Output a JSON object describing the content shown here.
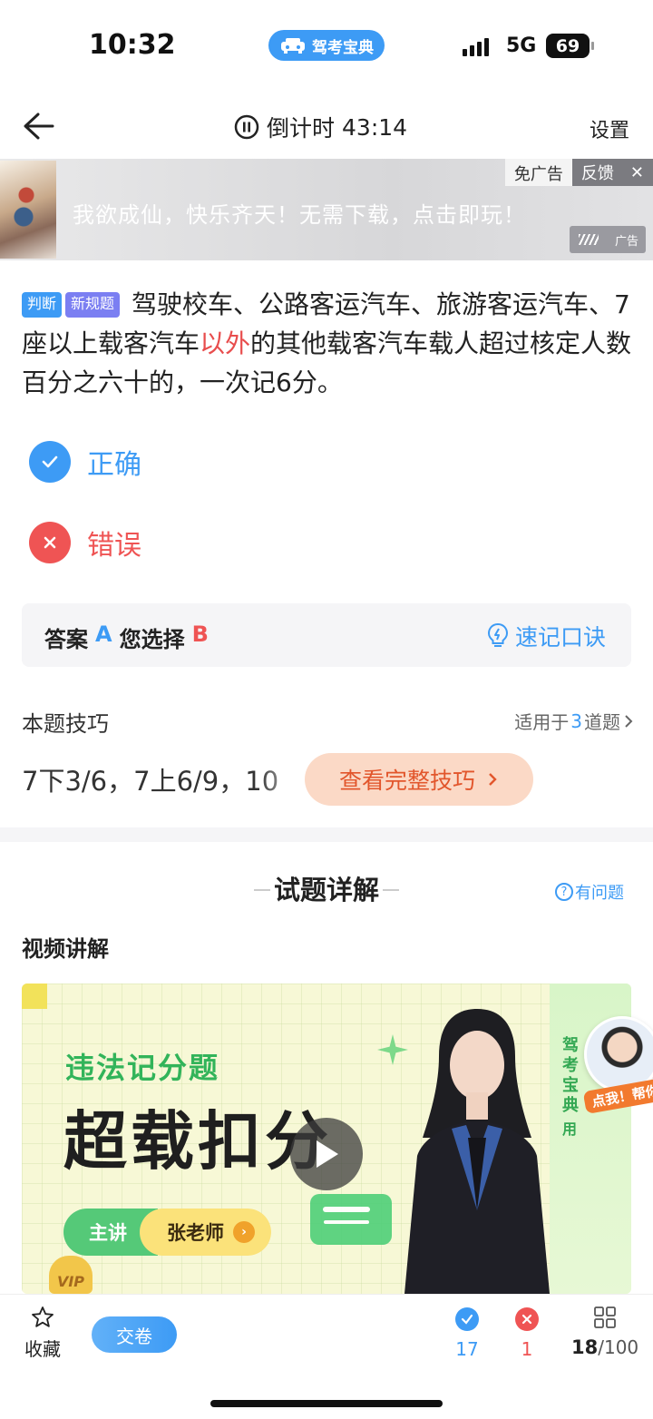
{
  "status_bar": {
    "time": "10:32",
    "app_pill": "驾考宝典",
    "network": "5G",
    "battery": "69"
  },
  "nav": {
    "timer_label": "倒计时",
    "timer_value": "43:14",
    "settings": "设置"
  },
  "ad": {
    "text": "我欲成仙，快乐齐天！无需下载，点击即玩！",
    "no_ads": "免广告",
    "feedback": "反馈",
    "close": "✕",
    "badge": "广告"
  },
  "question": {
    "tag_type": "判断",
    "tag_new": "新规题",
    "text_before": "驾驶校车、公路客运汽车、旅游客运汽车、7座以上载客汽车",
    "text_highlight": "以外",
    "text_after": "的其他载客汽车载人超过核定人数百分之六十的，一次记6分。"
  },
  "options": [
    {
      "label": "正确",
      "icon": "check-icon"
    },
    {
      "label": "错误",
      "icon": "cross-icon"
    }
  ],
  "answer": {
    "answer_label": "答案",
    "answer_value": "A",
    "chosen_label": "您选择",
    "chosen_value": "B",
    "mnemonic": "速记口诀"
  },
  "tips": {
    "title": "本题技巧",
    "applies_prefix": "适用于",
    "applies_count": "3",
    "applies_suffix": "道题",
    "content": "7下3/6，7上6/9，10",
    "button": "查看完整技巧"
  },
  "detail": {
    "title": "试题详解",
    "help": "有问题",
    "video_label": "视频讲解"
  },
  "video": {
    "subtitle": "违法记分题",
    "main_title": "超载扣分",
    "lecturer_label": "主讲",
    "lecturer_name": "张老师",
    "vip": "VIP",
    "brand_vertical": "驾考宝典",
    "brand_use": "用",
    "float_cta": "点我！帮你讲"
  },
  "bottom_bar": {
    "favorite": "收藏",
    "submit": "交卷",
    "correct_count": "17",
    "wrong_count": "1",
    "current": "18",
    "total": "/100"
  },
  "colors": {
    "primary_blue": "#3d9bf5",
    "error_red": "#ef5454",
    "accent_green": "#32b45a",
    "tips_orange": "#e2562c"
  }
}
